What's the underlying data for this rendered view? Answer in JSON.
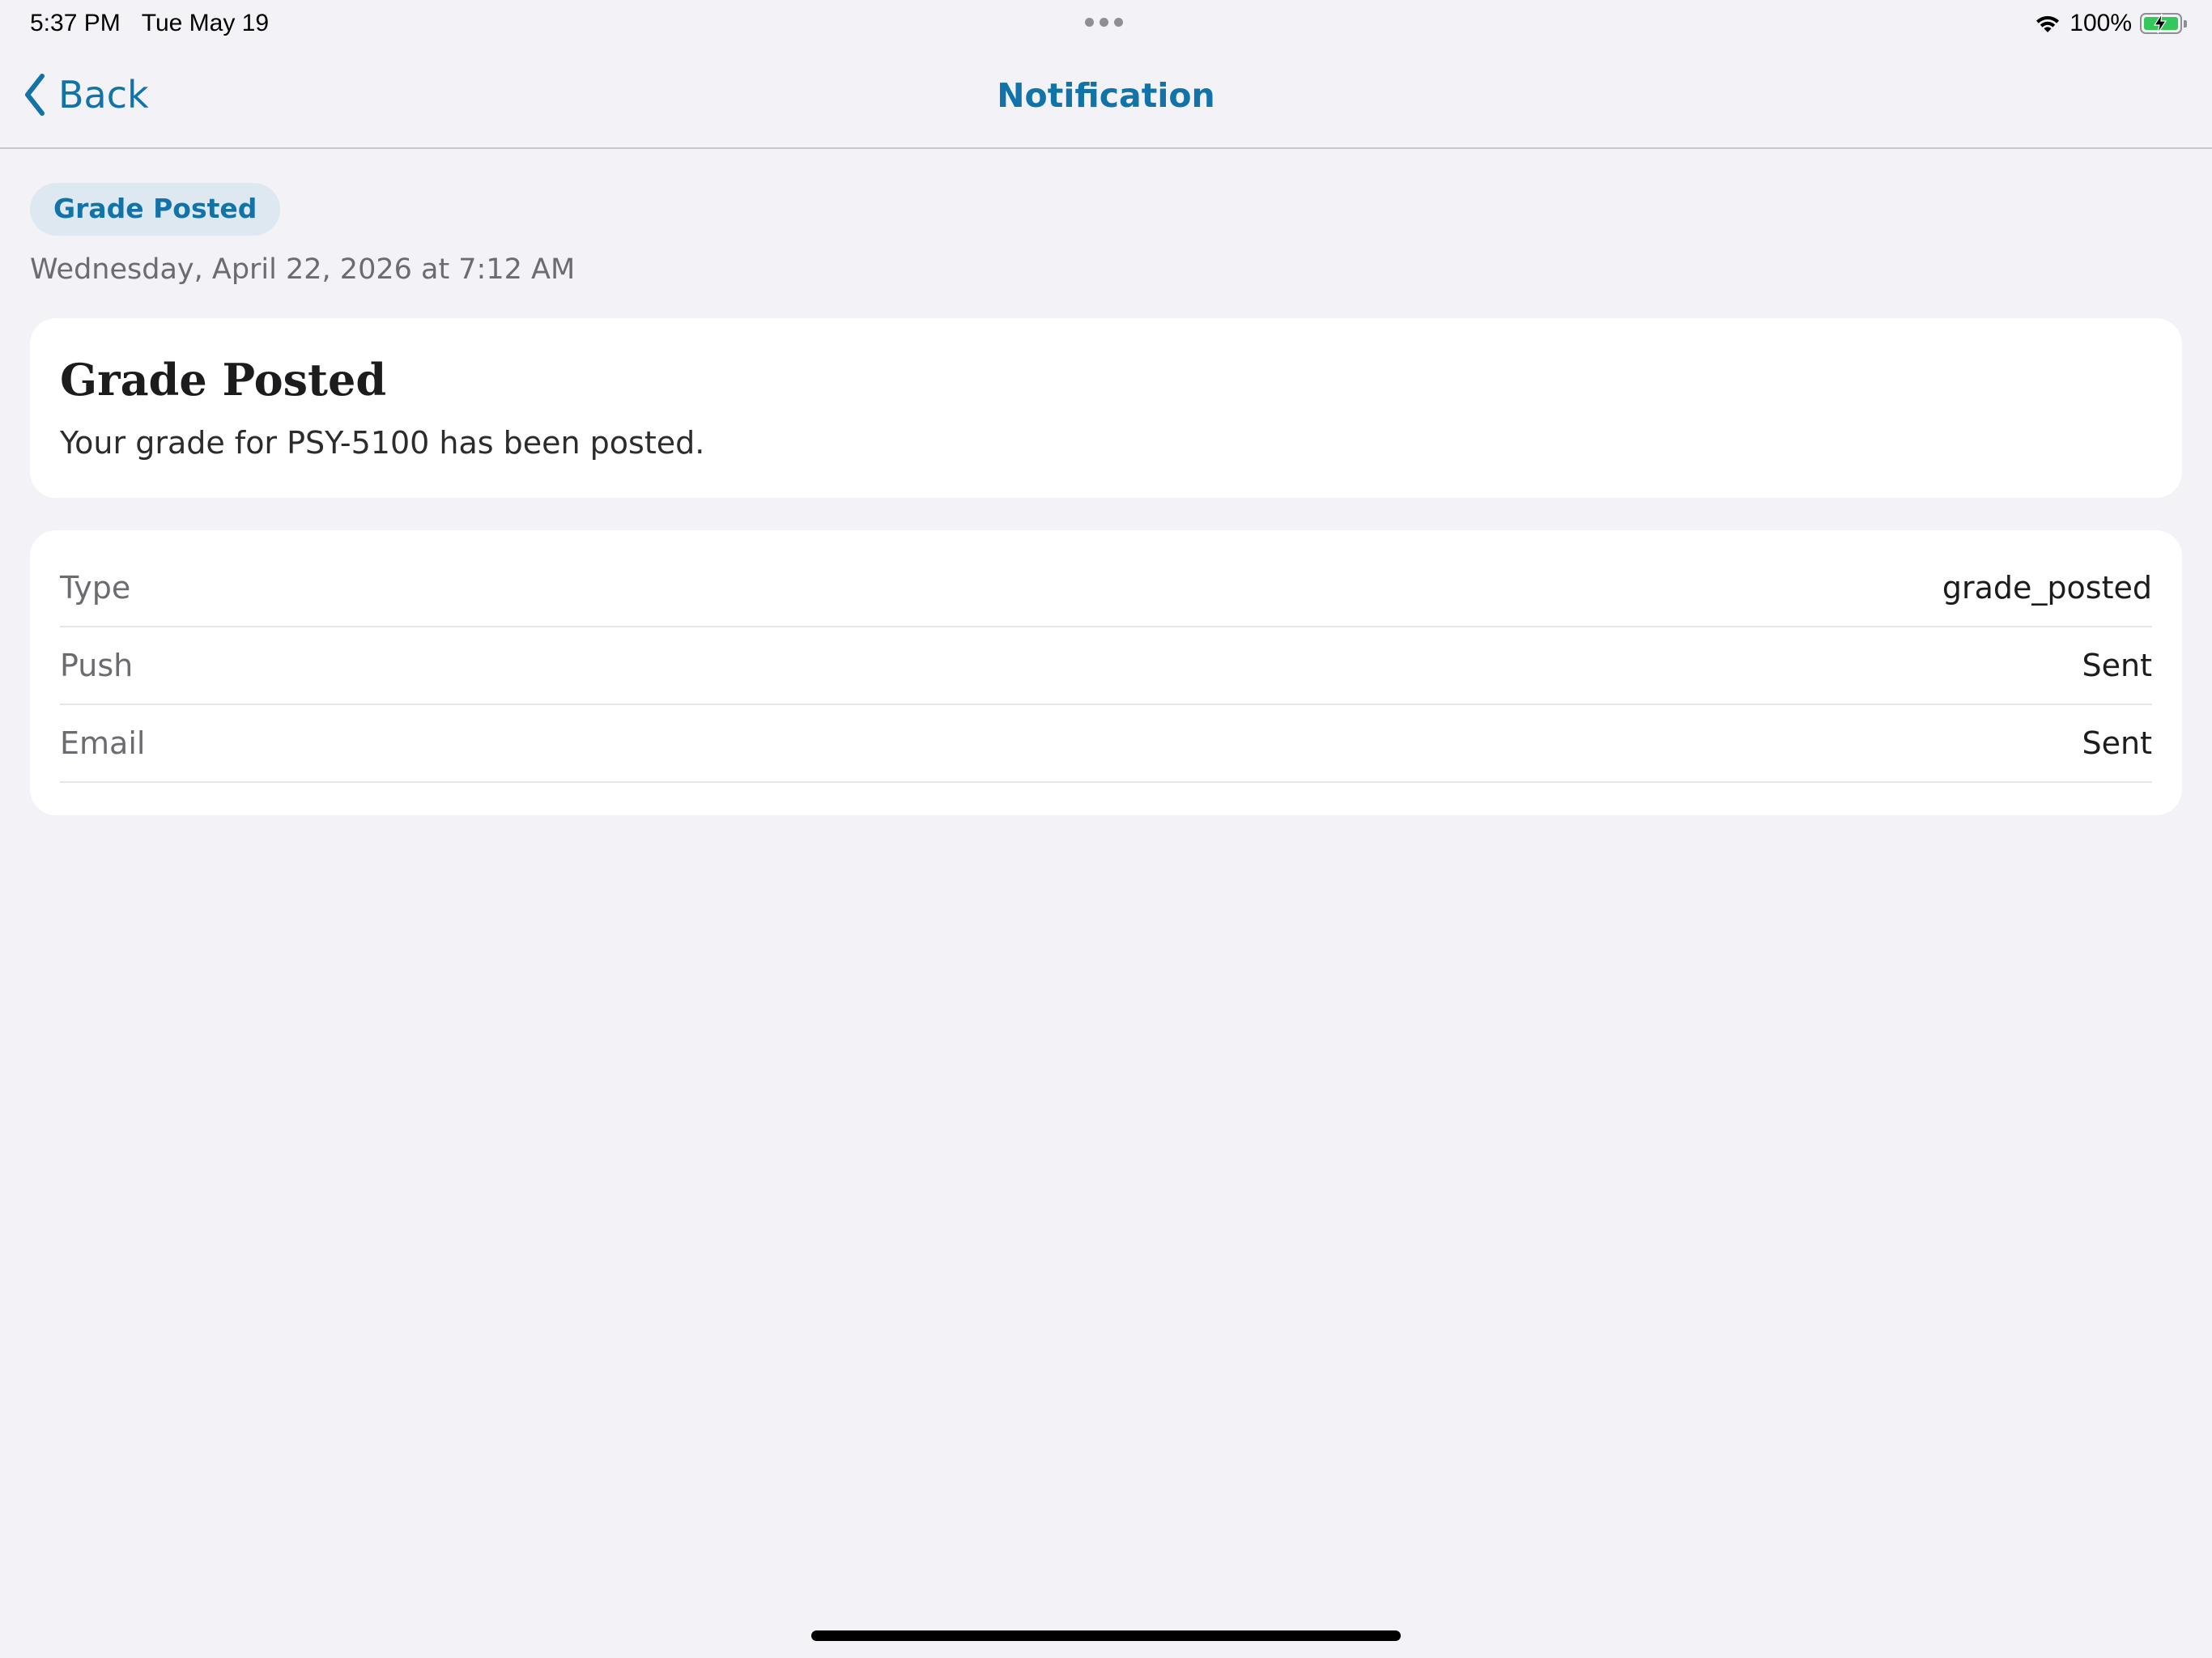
{
  "status_bar": {
    "time": "5:37 PM",
    "date": "Tue May 19",
    "battery_percent": "100%",
    "battery_level": 1.0,
    "icons": [
      "wifi-icon",
      "battery-charging-icon",
      "multitasking-dots-icon"
    ]
  },
  "nav": {
    "back_label": "Back",
    "title": "Notification",
    "back_icon": "chevron-left-icon"
  },
  "notification": {
    "badge": "Grade Posted",
    "timestamp": "Wednesday, April 22, 2026 at 7:12 AM",
    "title": "Grade Posted",
    "body": "Your grade for PSY-5100 has been posted."
  },
  "details": [
    {
      "label": "Type",
      "value": "grade_posted"
    },
    {
      "label": "Push",
      "value": "Sent"
    },
    {
      "label": "Email",
      "value": "Sent"
    }
  ],
  "colors": {
    "accent": "#1273a8",
    "background": "#f2f2f7",
    "card": "#ffffff",
    "badge_bg": "#dde8f1",
    "battery_green": "#34c759"
  }
}
